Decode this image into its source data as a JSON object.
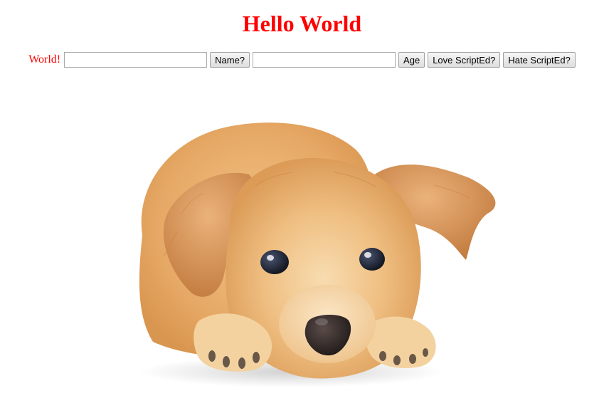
{
  "page": {
    "title": "Hello World",
    "title_color": "#ff0000"
  },
  "form": {
    "world_label": "World!",
    "world_label_color": "#ff0000",
    "name_input_value": "",
    "name_button": "Name?",
    "age_input_value": "",
    "age_button": "Age",
    "love_button": "Love ScriptEd?",
    "hate_button": "Hate ScriptEd?"
  },
  "image": {
    "subject": "puppy-photo"
  },
  "colors": {
    "fur_main": "#e7ad6c",
    "fur_light": "#f6d3a2",
    "fur_dark": "#c98240",
    "nose": "#2a2423",
    "eyes": "#1b1e2a"
  }
}
